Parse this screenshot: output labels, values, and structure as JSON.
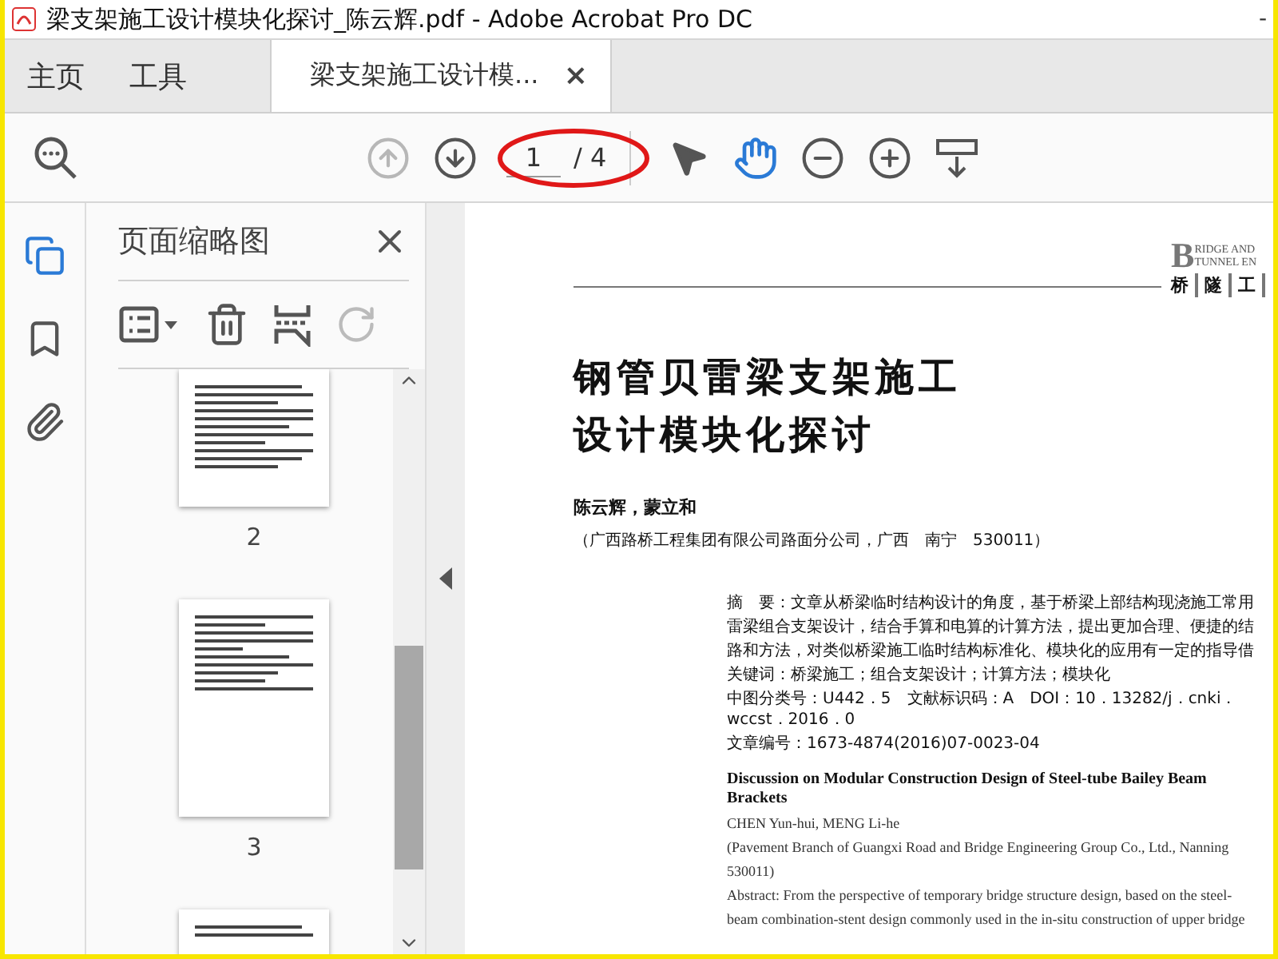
{
  "window": {
    "title": "梁支架施工设计模块化探讨_陈云辉.pdf - Adobe Acrobat Pro DC",
    "control": "-"
  },
  "tabs": [
    {
      "label": "主页",
      "kind": "nav",
      "selected": false
    },
    {
      "label": "工具",
      "kind": "nav",
      "selected": false
    },
    {
      "label": "梁支架施工设计模...",
      "kind": "document",
      "selected": true,
      "close": "×"
    }
  ],
  "toolbar": {
    "page_number": "1",
    "page_total": "/ 4",
    "highlighted": true,
    "tools": [
      {
        "kind": "prev",
        "disabled": true,
        "selected": false
      },
      {
        "kind": "next",
        "disabled": false,
        "selected": false
      },
      {
        "kind": "select",
        "disabled": false,
        "selected": false
      },
      {
        "kind": "hand",
        "disabled": false,
        "selected": true
      },
      {
        "kind": "zoom-out",
        "disabled": false,
        "selected": false
      },
      {
        "kind": "zoom-in",
        "disabled": false,
        "selected": false
      },
      {
        "kind": "scroll",
        "disabled": false,
        "selected": false
      }
    ]
  },
  "sidebar": {
    "items": [
      {
        "kind": "pages",
        "selected": true
      },
      {
        "kind": "bookmark",
        "selected": false
      },
      {
        "kind": "attachment",
        "selected": false
      }
    ]
  },
  "thumbnails_panel": {
    "title": "页面缩略图",
    "tools": [
      {
        "kind": "options",
        "disabled": false
      },
      {
        "kind": "delete",
        "disabled": false
      },
      {
        "kind": "insert",
        "disabled": false
      },
      {
        "kind": "redo",
        "disabled": true
      }
    ],
    "pages": [
      {
        "label": "2",
        "kind": "text"
      },
      {
        "label": "3",
        "kind": "figures"
      },
      {
        "kind": "partial"
      }
    ]
  },
  "document": {
    "journal_en": [
      "RIDGE AND",
      "TUNNEL EN"
    ],
    "journal_initial": "B",
    "journal_cn": [
      "桥",
      "隧",
      "工"
    ],
    "title": [
      "钢管贝雷梁支架施工",
      "设计模块化探讨"
    ],
    "authors": "陈云辉，蒙立和",
    "affiliation": "（广西路桥工程集团有限公司路面分公司，广西　南宁　530011）",
    "abstract": [
      "摘　要：文章从桥梁临时结构设计的角度，基于桥梁上部结构现浇施工常用",
      "雷梁组合支架设计，结合手算和电算的计算方法，提出更加合理、便捷的结",
      "路和方法，对类似桥梁施工临时结构标准化、模块化的应用有一定的指导借",
      "关键词：桥梁施工；组合支架设计；计算方法；模块化",
      "中图分类号：U442．5　文献标识码：A　DOI：10．13282/j．cnki．wccst．2016．0",
      "文章编号：1673-4874(2016)07-0023-04"
    ],
    "en_title": "Discussion on Modular Construction Design of Steel-tube Bailey Beam Brackets",
    "en_authors": "CHEN Yun-hui, MENG Li-he",
    "en_affiliation": [
      "(Pavement Branch of Guangxi Road and Bridge Engineering Group Co., Ltd., Nanning",
      "530011)"
    ],
    "en_abstract": [
      "Abstract: From the perspective of temporary bridge structure design, based on the steel-",
      "beam combination-stent design commonly used in the in-situ construction of upper bridge"
    ]
  }
}
